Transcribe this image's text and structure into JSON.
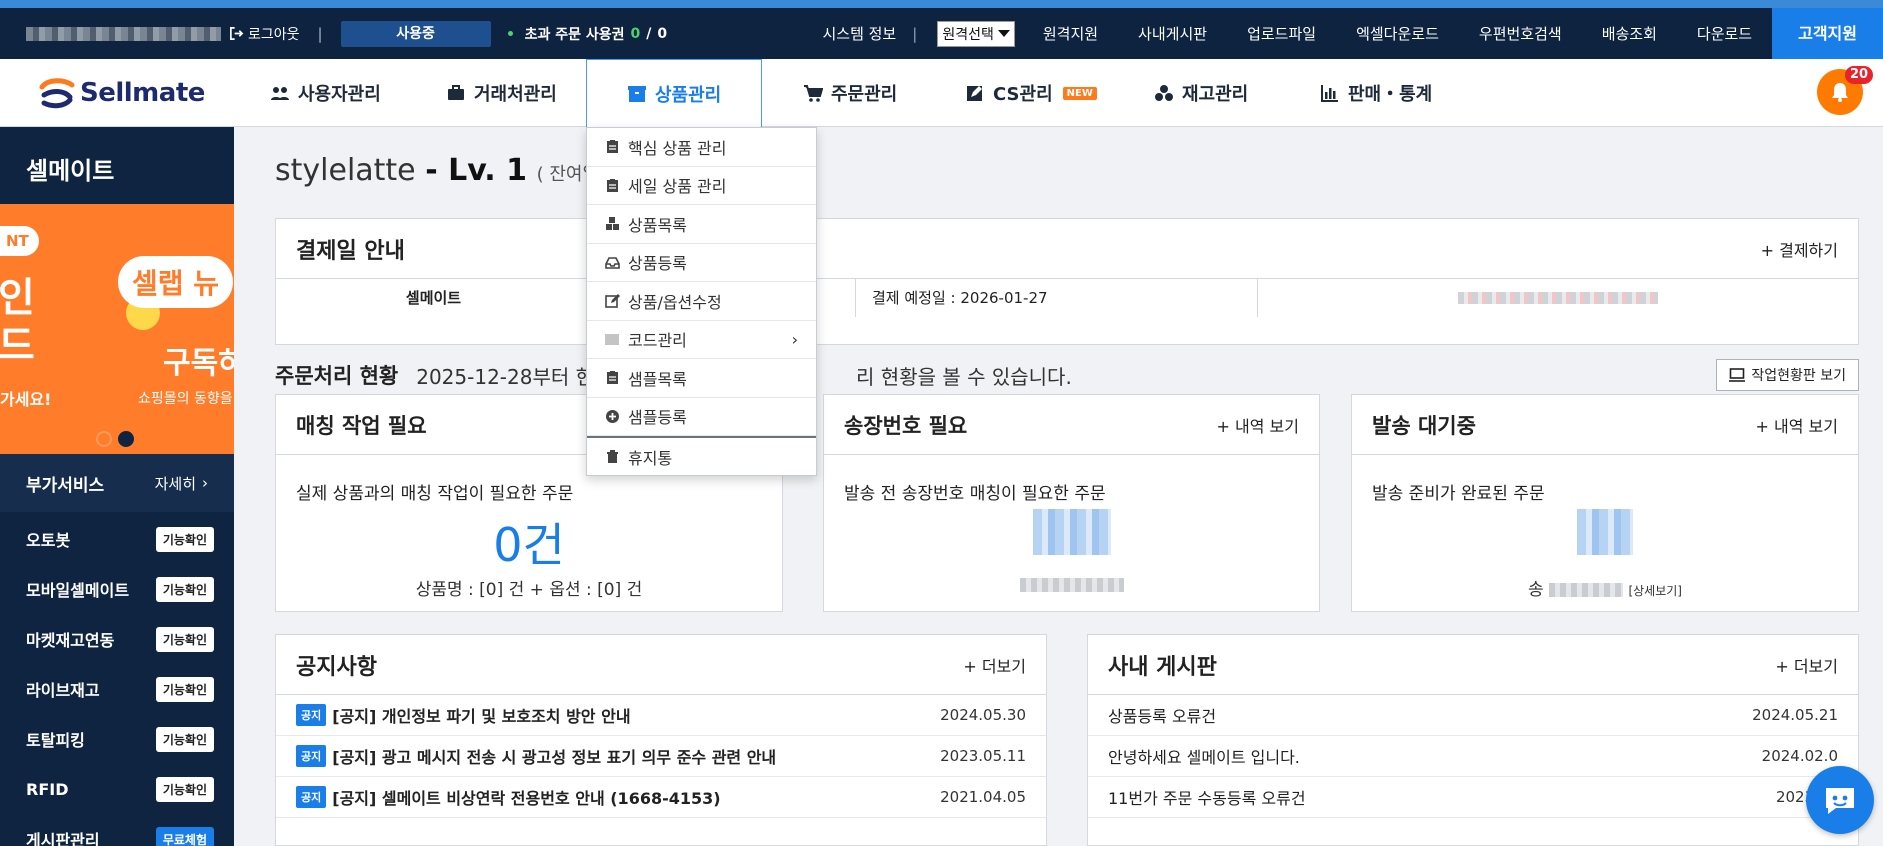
{
  "topbar": {
    "logout": "로그아웃",
    "status": "사용중",
    "excess_label": "초과 주문 사용권",
    "excess_used": "0",
    "excess_sep": "/",
    "excess_total": "0",
    "links": [
      "시스템 정보",
      "원격지원",
      "사내게시판",
      "업로드파일",
      "엑셀다운로드",
      "우편번호검색",
      "배송조회",
      "다운로드"
    ],
    "remote_select": "원격선택",
    "customer_center": "고객지원"
  },
  "nav": {
    "logo": "Sellmate",
    "items": [
      "사용자관리",
      "거래처관리",
      "상품관리",
      "주문관리",
      "CS관리",
      "재고관리",
      "판매・통계"
    ],
    "new_badge": "NEW",
    "bell_count": "20"
  },
  "sidebar": {
    "title": "셀메이트",
    "banner": {
      "tag": "NT",
      "big": "인\n드",
      "bottom": "가세요!",
      "bubble": "셀랩 뉴",
      "subscribe": "구독하",
      "news": "쇼핑몰의 동향을"
    },
    "addon_title": "부가서비스",
    "addon_more": "자세히",
    "items": [
      {
        "label": "오토봇",
        "chip": "기능확인"
      },
      {
        "label": "모바일셀메이트",
        "chip": "기능확인"
      },
      {
        "label": "마켓재고연동",
        "chip": "기능확인"
      },
      {
        "label": "라이브재고",
        "chip": "기능확인"
      },
      {
        "label": "토탈피킹",
        "chip": "기능확인"
      },
      {
        "label": "RFID",
        "chip": "기능확인"
      },
      {
        "label": "게시판관리",
        "chip": "무료체험"
      }
    ]
  },
  "main": {
    "title_user": "stylelatte",
    "title_level": "- Lv. 1",
    "title_rest": "( 잔여일 : (",
    "payment": {
      "title": "결제일 안내",
      "action": "+ 결제하기",
      "company": "셀메이트",
      "due": "결제 예정일 : 2026-01-27"
    },
    "order_status": {
      "title": "주문처리 현황",
      "desc_left": "2025-12-28부터 현",
      "desc_right": "리 현황을 볼 수 있습니다.",
      "board_btn": "작업현황판 보기"
    },
    "cards": [
      {
        "title": "매칭 작업 필요",
        "action": "",
        "sub": "실제 상품과의 매칭 작업이 필요한 주문",
        "value": "0건",
        "foot": "상품명 : [0] 건 + 옵션 : [0] 건"
      },
      {
        "title": "송장번호 필요",
        "action": "+ 내역 보기",
        "sub": "발송 전 송장번호 매칭이 필요한 주문",
        "value": "",
        "foot": ""
      },
      {
        "title": "발송 대기중",
        "action": "+ 내역 보기",
        "sub": "발송 준비가 완료된 주문",
        "value": "",
        "foot_prefix": "송",
        "detail": "[상세보기]"
      }
    ],
    "notice": {
      "title": "공지사항",
      "more": "+ 더보기",
      "tag": "공지",
      "rows": [
        {
          "title": "[공지] 개인정보 파기 및 보호조치 방안 안내",
          "date": "2024.05.30"
        },
        {
          "title": "[공지] 광고 메시지 전송 시 광고성 정보 표기 의무 준수 관련 안내",
          "date": "2023.05.11"
        },
        {
          "title": "[공지] 셀메이트 비상연락 전용번호 안내 (1668-4153)",
          "date": "2021.04.05"
        }
      ]
    },
    "board": {
      "title": "사내 게시판",
      "more": "+ 더보기",
      "rows": [
        {
          "title": "상품등록 오류건",
          "date": "2024.05.21"
        },
        {
          "title": "안녕하세요 셀메이트 입니다.",
          "date": "2024.02.0"
        },
        {
          "title": "11번가 주문 수동등록 오류건",
          "date": "2023.10"
        }
      ]
    }
  },
  "dropdown": {
    "items": [
      "핵심 상품 관리",
      "세일 상품 관리",
      "상품목록",
      "상품등록",
      "상품/옵션수정",
      "코드관리",
      "샘플목록",
      "샘플등록",
      "휴지통"
    ]
  },
  "colors": {
    "navy": "#0d2340",
    "accent": "#1a7ee8",
    "orange": "#ff7a00"
  }
}
